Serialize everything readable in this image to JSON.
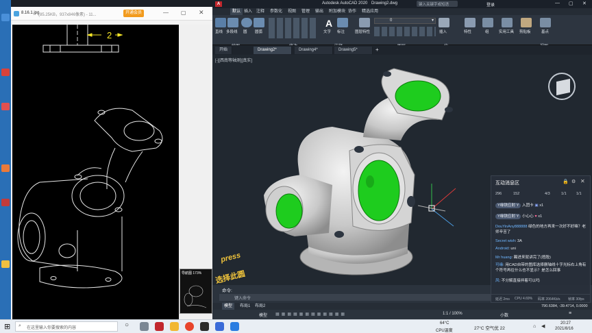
{
  "viewer": {
    "title": "8.16.1.jpg",
    "meta": "(85.25KB，937x846像素) - 11...",
    "open_btn": "开通会员",
    "dimension_label": "2",
    "thumb_label": "导航图 173%"
  },
  "acad": {
    "app_title": "Autodesk AutoCAD 2020",
    "doc_name": "Drawing2.dwg",
    "search_placeholder": "键入关键字或短语",
    "login": "登录",
    "ribbon_tabs": [
      "默认",
      "插入",
      "注释",
      "参数化",
      "视图",
      "管理",
      "输出",
      "附加模块",
      "协作",
      "精选应用"
    ],
    "panels": [
      {
        "name": "绘图",
        "tools": [
          "直线",
          "多段线",
          "圆",
          "圆弧"
        ]
      },
      {
        "name": "修改",
        "tools": []
      },
      {
        "name": "注释",
        "tools": [
          "文字",
          "标注"
        ]
      },
      {
        "name": "图层",
        "tools": [
          "图层特性"
        ]
      },
      {
        "name": "块",
        "tools": [
          "插入"
        ]
      },
      {
        "name": "特性",
        "tools": [
          "特性"
        ]
      },
      {
        "name": "组",
        "tools": [
          "组"
        ]
      },
      {
        "name": "实用工具",
        "tools": [
          "实用工具"
        ]
      },
      {
        "name": "剪贴板",
        "tools": [
          "剪贴板"
        ]
      },
      {
        "name": "视图",
        "tools": [
          "基点"
        ]
      }
    ],
    "layer_value": "0",
    "doc_tabs": [
      "开始",
      "Drawing2*",
      "Drawing4*",
      "Drawing5*"
    ],
    "viewport_label": "[-][西南等轴测][真实]",
    "command_label": "命令:",
    "command_placeholder": "键入命令",
    "layout_tabs": [
      "模型",
      "布局1",
      "布局2"
    ],
    "coords": "790.6384, -39.4714, 0.0000",
    "model_label": "模型",
    "scale": "1:1 / 100%",
    "decimal": "小数"
  },
  "chat": {
    "title": "互动消息区",
    "stats": [
      "296",
      "152",
      "4/3",
      "1/1",
      "1/1"
    ],
    "lines": [
      {
        "user": "Y缘铁应射 Y",
        "text": "入团卡",
        "count": "x1"
      },
      {
        "user": "Y缘铁应射 Y",
        "text": "小心心",
        "count": "x1"
      },
      {
        "user": "DouYinAny888888",
        "text": "绿色的地方再来一次好不好嘛？老师辛苦了"
      },
      {
        "user": "Secret wish",
        "text": "3A"
      },
      {
        "user": "Android",
        "text": "uni"
      },
      {
        "user": "Mr huang",
        "text": "踢进来就讲完了(捂脸)"
      },
      {
        "user": "可缘",
        "text": "用CAD自带的图库选择删轴线十字光标右上角有个符号再往什么也不显示？是怎么回事"
      },
      {
        "user": "风",
        "text": "不分解直接拌着可以吗"
      }
    ],
    "footer": [
      "延迟 2ms",
      "CPU 4.69%",
      "码率 2064Kb/s",
      "帧率 30fps"
    ]
  },
  "overlay_text": [
    "press",
    "选择此圆"
  ],
  "taskbar": {
    "search_placeholder": "在这里输入你要搜索的内容",
    "cpu_temp": "64°C",
    "cpu_label": "CPU温度",
    "weather": "27°C 空气优 22",
    "time": "20:27",
    "date": "2021/8/16"
  },
  "colors": {
    "accent_green": "#1ecc1e",
    "cad_bg": "#212830",
    "gizmo_red": "#d93a3a"
  }
}
